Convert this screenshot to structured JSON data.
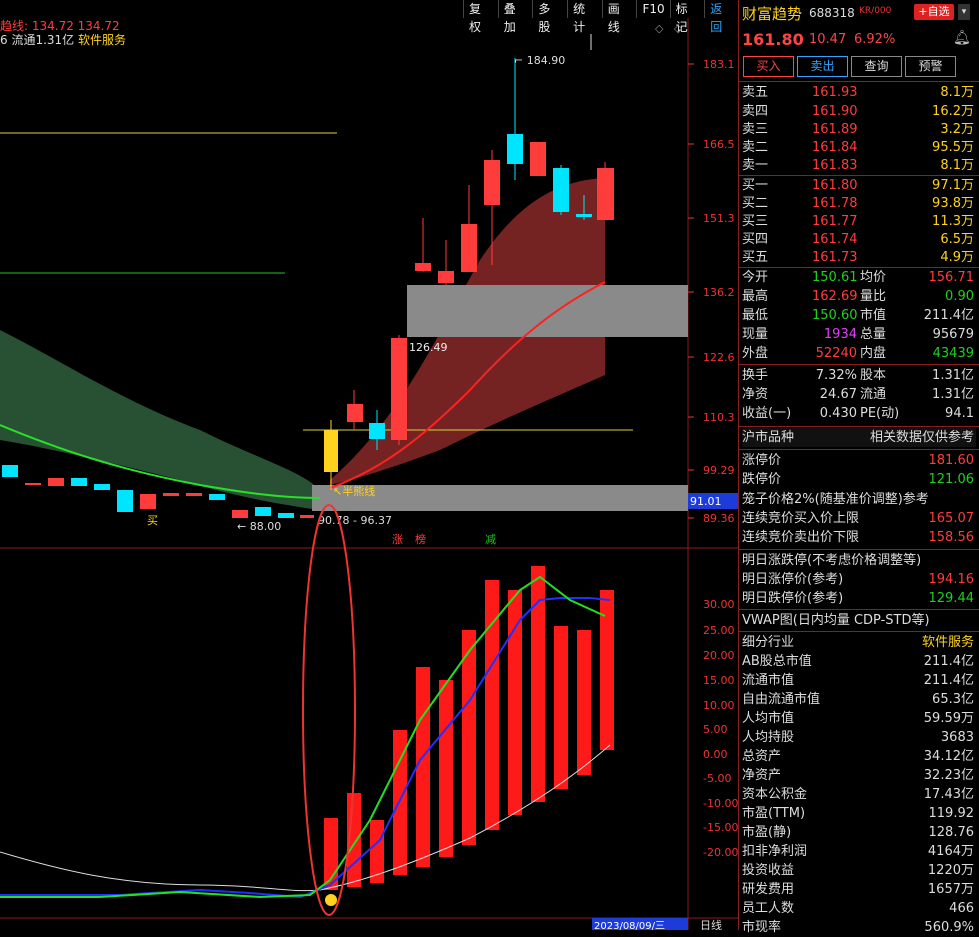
{
  "toolbar": {
    "items": [
      "复权",
      "叠加",
      "多股",
      "统计",
      "画线",
      "F10",
      "标记"
    ],
    "back": "返回"
  },
  "chart_header": {
    "line1": "趋线: 134.72  134.72",
    "line2_a": "6 流通1.31亿",
    "line2_b": "软件服务"
  },
  "price_axis": [
    "183.1",
    "166.5",
    "151.3",
    "136.2",
    "122.6",
    "110.3",
    "99.29",
    "91.01",
    "89.36"
  ],
  "indicator_axis": [
    "30.00",
    "25.00",
    "20.00",
    "15.00",
    "10.00",
    "5.00",
    "0.00",
    "-5.00",
    "-10.00",
    "-15.00",
    "-20.00"
  ],
  "annotations": {
    "high": "184.90",
    "low": "88.00",
    "range": "90.78 - 96.37",
    "level": "126.49",
    "half_line": "半熊线",
    "buy": "买",
    "zhang": "涨",
    "bang": "榜",
    "jian": "减",
    "date": "2023/08/09/三",
    "period": "日线"
  },
  "stock": {
    "name": "财富趋势",
    "code": "688318",
    "kr": "KR/000",
    "add": "+自选",
    "price": "161.80",
    "change": "10.47",
    "pct": "6.92%"
  },
  "trade_buttons": {
    "buy": "买入",
    "sell": "卖出",
    "query": "查询",
    "warn": "预警"
  },
  "asks": [
    {
      "label": "卖五",
      "price": "161.93",
      "vol": "8.1万"
    },
    {
      "label": "卖四",
      "price": "161.90",
      "vol": "16.2万"
    },
    {
      "label": "卖三",
      "price": "161.89",
      "vol": "3.2万"
    },
    {
      "label": "卖二",
      "price": "161.84",
      "vol": "95.5万"
    },
    {
      "label": "卖一",
      "price": "161.83",
      "vol": "8.1万"
    }
  ],
  "bids": [
    {
      "label": "买一",
      "price": "161.80",
      "vol": "97.1万"
    },
    {
      "label": "买二",
      "price": "161.78",
      "vol": "93.8万"
    },
    {
      "label": "买三",
      "price": "161.77",
      "vol": "11.3万"
    },
    {
      "label": "买四",
      "price": "161.74",
      "vol": "6.5万"
    },
    {
      "label": "买五",
      "price": "161.73",
      "vol": "4.9万"
    }
  ],
  "quote": [
    {
      "l1": "今开",
      "v1": "150.61",
      "l2": "均价",
      "v2": "156.71"
    },
    {
      "l1": "最高",
      "v1": "162.69",
      "l2": "量比",
      "v2": "0.90"
    },
    {
      "l1": "最低",
      "v1": "150.60",
      "l2": "市值",
      "v2": "211.4亿"
    },
    {
      "l1": "现量",
      "v1": "1934",
      "l2": "总量",
      "v2": "95679"
    },
    {
      "l1": "外盘",
      "v1": "52240",
      "l2": "内盘",
      "v2": "43439"
    }
  ],
  "quote2": [
    {
      "l1": "换手",
      "v1": "7.32%",
      "l2": "股本",
      "v2": "1.31亿"
    },
    {
      "l1": "净资",
      "v1": "24.67",
      "l2": "流通",
      "v2": "1.31亿"
    },
    {
      "l1": "收益(一)",
      "v1": "0.430",
      "l2": "PE(动)",
      "v2": "94.1"
    }
  ],
  "market": {
    "label": "沪市品种",
    "note": "相关数据仅供参考"
  },
  "limits": [
    {
      "l": "涨停价",
      "v": "181.60"
    },
    {
      "l": "跌停价",
      "v": "121.06"
    },
    {
      "l": "笼子价格2%(随基准价调整)参考",
      "v": ""
    },
    {
      "l": "连续竞价买入价上限",
      "v": "165.07"
    },
    {
      "l": "连续竞价卖出价下限",
      "v": "158.56"
    }
  ],
  "tomorrow": [
    {
      "l": "明日涨跌停(不考虑价格调整等)",
      "v": ""
    },
    {
      "l": "明日涨停价(参考)",
      "v": "194.16"
    },
    {
      "l": "明日跌停价(参考)",
      "v": "129.44"
    }
  ],
  "vwap": "VWAP图(日内均量 CDP-STD等)",
  "fundamentals": [
    {
      "l": "细分行业",
      "v": "软件服务"
    },
    {
      "l": "AB股总市值",
      "v": "211.4亿"
    },
    {
      "l": "流通市值",
      "v": "211.4亿"
    },
    {
      "l": "自由流通市值",
      "v": "65.3亿"
    },
    {
      "l": "人均市值",
      "v": "59.59万"
    },
    {
      "l": "人均持股",
      "v": "3683"
    },
    {
      "l": "总资产",
      "v": "34.12亿"
    },
    {
      "l": "净资产",
      "v": "32.23亿"
    },
    {
      "l": "资本公积金",
      "v": "17.43亿"
    },
    {
      "l": "市盈(TTM)",
      "v": "119.92"
    },
    {
      "l": "市盈(静)",
      "v": "128.76"
    },
    {
      "l": "扣非净利润",
      "v": "4164万"
    },
    {
      "l": "投资收益",
      "v": "1220万"
    },
    {
      "l": "研发费用",
      "v": "1657万"
    },
    {
      "l": "员工人数",
      "v": "466"
    },
    {
      "l": "市现率",
      "v": "560.9%"
    }
  ]
}
